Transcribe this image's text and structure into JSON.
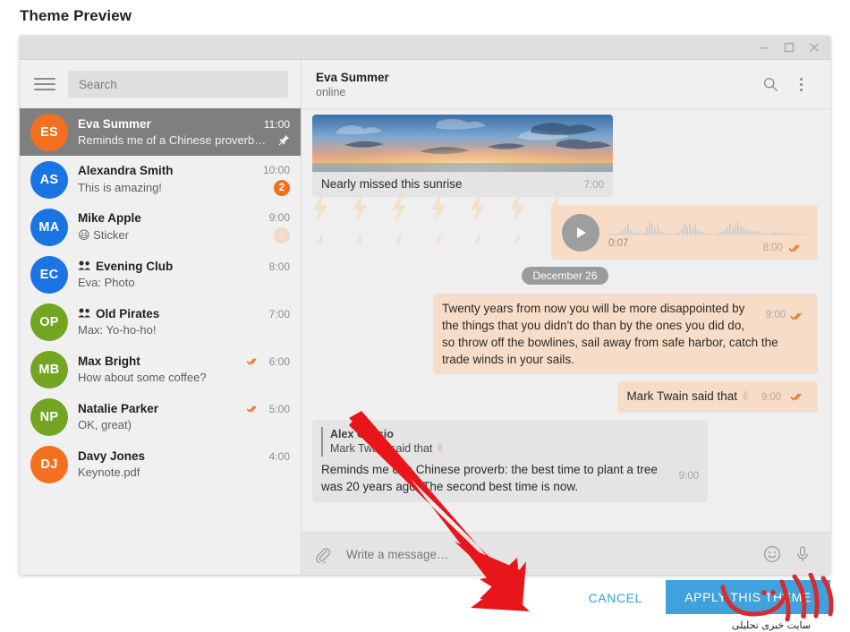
{
  "dialog": {
    "title": "Theme Preview",
    "cancel_label": "CANCEL",
    "apply_label": "APPLY THIS THEME"
  },
  "window_controls": {
    "minimize": "minimize-icon",
    "maximize": "maximize-icon",
    "close": "close-icon"
  },
  "sidebar": {
    "menu_icon": "hamburger-icon",
    "search_placeholder": "Search",
    "chats": [
      {
        "initials": "ES",
        "name": "Eva Summer",
        "preview": "Reminds me of a Chinese proverb…",
        "time": "11:00",
        "color": "#f4701f",
        "active": true,
        "pinned": true,
        "group": false,
        "badge": "",
        "badge_muted": false,
        "sent": false
      },
      {
        "initials": "AS",
        "name": "Alexandra Smith",
        "preview": "This is amazing!",
        "time": "10:00",
        "color": "#1b74e4",
        "active": false,
        "pinned": false,
        "group": false,
        "badge": "2",
        "badge_muted": false,
        "sent": false
      },
      {
        "initials": "MA",
        "name": "Mike Apple",
        "preview": "Sticker",
        "emoji": "😃",
        "time": "9:00",
        "color": "#1b74e4",
        "active": false,
        "pinned": false,
        "group": false,
        "badge": "2",
        "badge_muted": true,
        "sent": false
      },
      {
        "initials": "EC",
        "name": "Evening Club",
        "preview": "Eva: Photo",
        "time": "8:00",
        "color": "#1b74e4",
        "active": false,
        "pinned": false,
        "group": true,
        "badge": "",
        "badge_muted": false,
        "sent": false
      },
      {
        "initials": "OP",
        "name": "Old Pirates",
        "preview": "Max: Yo-ho-ho!",
        "time": "7:00",
        "color": "#74a522",
        "active": false,
        "pinned": false,
        "group": true,
        "badge": "",
        "badge_muted": false,
        "sent": false
      },
      {
        "initials": "MB",
        "name": "Max Bright",
        "preview": "How about some coffee?",
        "time": "6:00",
        "color": "#74a522",
        "active": false,
        "pinned": false,
        "group": false,
        "badge": "",
        "badge_muted": false,
        "sent": true
      },
      {
        "initials": "NP",
        "name": "Natalie Parker",
        "preview": "OK, great)",
        "time": "5:00",
        "color": "#74a522",
        "active": false,
        "pinned": false,
        "group": false,
        "badge": "",
        "badge_muted": false,
        "sent": true
      },
      {
        "initials": "DJ",
        "name": "Davy Jones",
        "preview": "Keynote.pdf",
        "time": "4:00",
        "color": "#f4701f",
        "active": false,
        "pinned": false,
        "group": false,
        "badge": "",
        "badge_muted": false,
        "sent": false
      }
    ]
  },
  "chat": {
    "title": "Eva Summer",
    "status": "online",
    "search_icon": "search-icon",
    "menu_icon": "kebab-menu-icon",
    "date_separator": "December 26",
    "messages": {
      "photo": {
        "caption": "Nearly missed this sunrise",
        "time": "7:00"
      },
      "voice": {
        "duration": "0:07",
        "time": "8:00",
        "play_icon": "play-icon"
      },
      "quote": {
        "text": "Twenty years from now you will be more disappointed by the things that you didn't do than by the ones you did do, so throw off the bowlines, sail away from safe harbor, catch the trade winds in your sails.",
        "time": "9:00"
      },
      "attrib": {
        "text": "Mark Twain said that",
        "emoji": "✌",
        "time": "9:00"
      },
      "reply": {
        "author": "Alex Cassio",
        "quoted": "Mark Twain said that",
        "quoted_emoji": "✌",
        "text": "Reminds me of a Chinese proverb: the best time to plant a tree was 20 years ago. The second best time is now.",
        "time": "9:00"
      }
    },
    "composer": {
      "attach_icon": "paperclip-icon",
      "placeholder": "Write a message…",
      "emoji_icon": "smiley-icon",
      "mic_icon": "microphone-icon"
    }
  },
  "watermark": {
    "title": "بولتن",
    "subtitle": "سایت خبری تحلیلی"
  },
  "colors": {
    "accent_orange": "#f4701f",
    "accent_blue": "#1b74e4",
    "accent_green": "#74a522",
    "button_blue": "#3fa2dd",
    "out_bubble": "#f7ddc8",
    "in_bubble": "#e4e4e4",
    "arrow_red": "#e8161a"
  }
}
